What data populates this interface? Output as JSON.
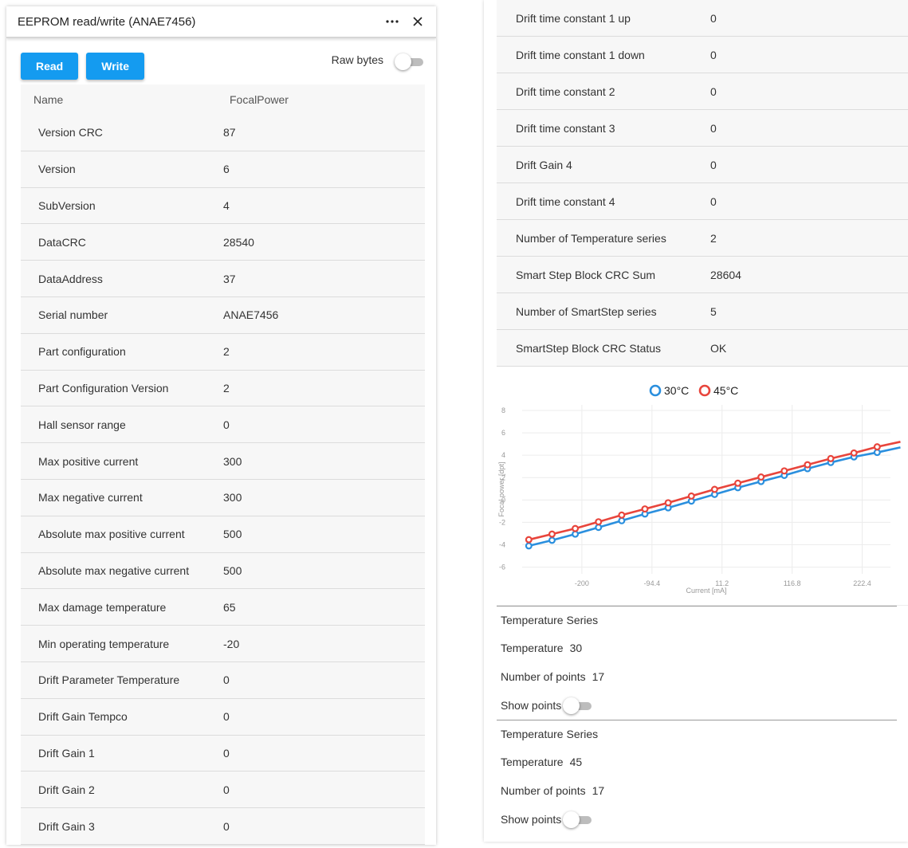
{
  "window": {
    "title": "EEPROM read/write (ANAE7456)",
    "more_icon": "more-horizontal-icon",
    "close_icon": "close-icon"
  },
  "toolbar": {
    "read_label": "Read",
    "write_label": "Write",
    "raw_bytes_label": "Raw bytes",
    "raw_bytes_on": false
  },
  "table": {
    "headers": [
      "Name",
      "FocalPower"
    ],
    "rows": [
      {
        "name": "Version CRC",
        "value": "87"
      },
      {
        "name": "Version",
        "value": "6"
      },
      {
        "name": "SubVersion",
        "value": "4"
      },
      {
        "name": "DataCRC",
        "value": "28540"
      },
      {
        "name": "DataAddress",
        "value": "37"
      },
      {
        "name": "Serial number",
        "value": "ANAE7456"
      },
      {
        "name": "Part configuration",
        "value": "2"
      },
      {
        "name": "Part Configuration Version",
        "value": "2"
      },
      {
        "name": "Hall sensor range",
        "value": "0"
      },
      {
        "name": "Max positive current",
        "value": "300"
      },
      {
        "name": "Max negative current",
        "value": "300"
      },
      {
        "name": "Absolute max positive current",
        "value": "500"
      },
      {
        "name": "Absolute max negative current",
        "value": "500"
      },
      {
        "name": "Max damage temperature",
        "value": "65"
      },
      {
        "name": "Min operating temperature",
        "value": "-20"
      },
      {
        "name": "Drift Parameter Temperature",
        "value": "0"
      },
      {
        "name": "Drift Gain Tempco",
        "value": "0"
      },
      {
        "name": "Drift Gain 1",
        "value": "0"
      },
      {
        "name": "Drift Gain 2",
        "value": "0"
      },
      {
        "name": "Drift Gain 3",
        "value": "0"
      }
    ]
  },
  "right_table": {
    "rows": [
      {
        "name": "Drift time constant 1 up",
        "value": "0"
      },
      {
        "name": "Drift time constant 1 down",
        "value": "0"
      },
      {
        "name": "Drift time constant 2",
        "value": "0"
      },
      {
        "name": "Drift time constant 3",
        "value": "0"
      },
      {
        "name": "Drift Gain 4",
        "value": "0"
      },
      {
        "name": "Drift time constant 4",
        "value": "0"
      },
      {
        "name": "Number of Temperature series",
        "value": "2"
      },
      {
        "name": "Smart Step Block CRC Sum",
        "value": "28604"
      },
      {
        "name": "Number of SmartStep series",
        "value": "5"
      },
      {
        "name": "SmartStep Block CRC Status",
        "value": "OK"
      }
    ]
  },
  "chart_data": {
    "type": "line",
    "xlabel": "Current [mA]",
    "ylabel": "Focal power [dpt]",
    "xlim": [
      -290,
      265
    ],
    "ylim": [
      -6.6,
      8.5
    ],
    "x_ticks": [
      "-200",
      "-94.4",
      "11.2",
      "116.8",
      "222.4"
    ],
    "x_tick_values": [
      -200,
      -94.4,
      11.2,
      116.8,
      222.4
    ],
    "y_ticks": [
      -6,
      -4,
      -2,
      0,
      2,
      4,
      6,
      8
    ],
    "grid": true,
    "legend_position": "top",
    "x": [
      -280,
      -245,
      -210,
      -175,
      -140,
      -105,
      -70,
      -35,
      0,
      35,
      70,
      105,
      140,
      175,
      210,
      245,
      280
    ],
    "series": [
      {
        "name": "30°C",
        "color": "#2a8fde",
        "values": [
          -4.1,
          -3.6,
          -3.05,
          -2.45,
          -1.85,
          -1.25,
          -0.7,
          -0.1,
          0.5,
          1.1,
          1.65,
          2.2,
          2.8,
          3.35,
          3.85,
          4.25,
          4.7
        ]
      },
      {
        "name": "45°C",
        "color": "#e8453c",
        "values": [
          -3.55,
          -3.05,
          -2.55,
          -1.95,
          -1.35,
          -0.8,
          -0.25,
          0.35,
          0.95,
          1.5,
          2.05,
          2.6,
          3.15,
          3.7,
          4.2,
          4.75,
          5.2
        ]
      }
    ]
  },
  "temperature_series": [
    {
      "title": "Temperature Series",
      "temperature_label": "Temperature",
      "temperature": "30",
      "points_label": "Number of points",
      "points": "17",
      "show_points_label": "Show points",
      "show_points": false
    },
    {
      "title": "Temperature Series",
      "temperature_label": "Temperature",
      "temperature": "45",
      "points_label": "Number of points",
      "points": "17",
      "show_points_label": "Show points",
      "show_points": false
    }
  ]
}
